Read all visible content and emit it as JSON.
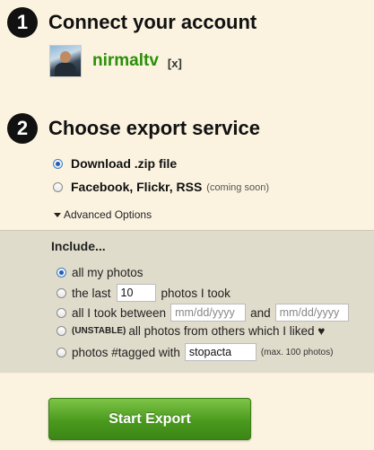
{
  "step1": {
    "number": "1",
    "title": "Connect your account"
  },
  "account": {
    "username": "nirmaltv",
    "remove": "[x]"
  },
  "step2": {
    "number": "2",
    "title": "Choose export service"
  },
  "services": {
    "zip_label": "Download .zip file",
    "social_label": "Facebook, Flickr, RSS",
    "social_note": "(coming soon)",
    "selected": "zip"
  },
  "advanced": {
    "label": "Advanced Options"
  },
  "include": {
    "heading": "Include...",
    "all_photos": "all my photos",
    "last_prefix": "the last",
    "last_value": "10",
    "last_suffix": "photos I took",
    "between_prefix": "all I took between",
    "date_placeholder": "mm/dd/yyyy",
    "between_and": "and",
    "unstable_tag": "(UNSTABLE)",
    "liked_label": "all photos from others which I liked ♥",
    "tagged_prefix": "photos #tagged with",
    "tagged_value": "stopacta",
    "tagged_note": "(max. 100 photos)",
    "selected": "all_photos"
  },
  "button": {
    "label": "Start Export"
  }
}
